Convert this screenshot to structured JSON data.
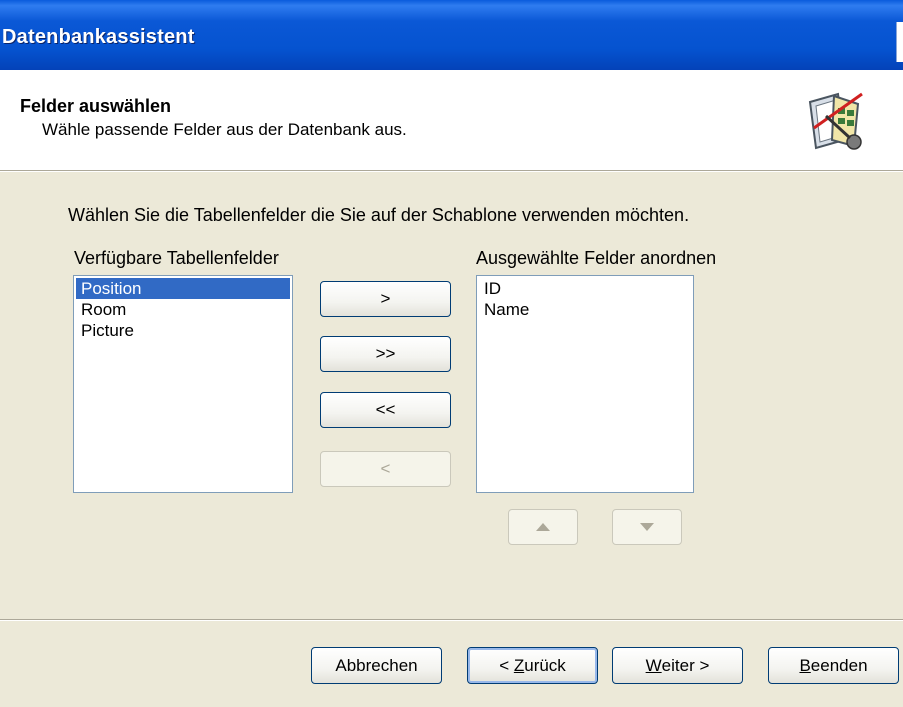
{
  "window": {
    "title": "Datenbankassistent"
  },
  "header": {
    "title": "Felder auswählen",
    "subtitle": "Wähle passende Felder aus der Datenbank aus.",
    "icon": "wizard-document-icon"
  },
  "instruction": "Wählen Sie die Tabellenfelder die Sie auf der Schablone verwenden möchten.",
  "available": {
    "label": "Verfügbare Tabellenfelder",
    "items": [
      "Position",
      "Room",
      "Picture"
    ],
    "selected": "Position"
  },
  "selected_fields": {
    "label": "Ausgewählte Felder anordnen",
    "items": [
      "ID",
      "Name"
    ]
  },
  "transfer_buttons": {
    "add": ">",
    "add_all": ">>",
    "remove_all": "<<",
    "remove": "<"
  },
  "order_buttons": {
    "up": "move-up-arrow-icon",
    "down": "move-down-arrow-icon"
  },
  "footer": {
    "cancel": "Abbrechen",
    "back_prefix": "< ",
    "back_mnemonic": "Z",
    "back_rest": "urück",
    "next_mnemonic": "W",
    "next_rest": "eiter >",
    "finish_mnemonic": "B",
    "finish_rest": "eenden"
  },
  "colors": {
    "titlebar": "#0553d0",
    "dialog_bg": "#ece9d8",
    "selection": "#316ac5"
  }
}
